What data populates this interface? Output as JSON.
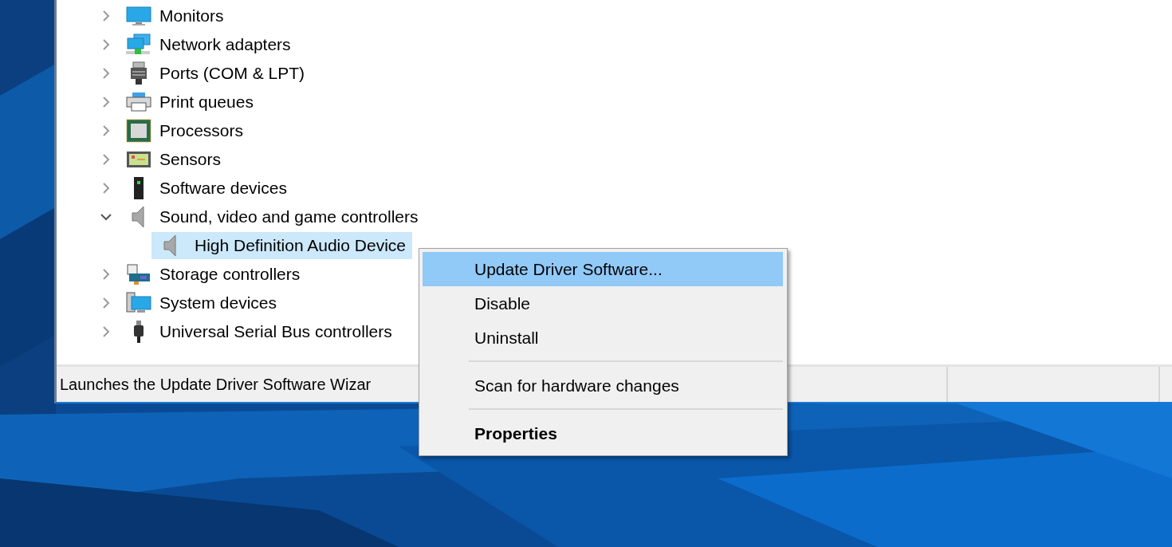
{
  "tree": [
    {
      "label": "Monitors",
      "expanded": false,
      "selected": false
    },
    {
      "label": "Network adapters",
      "expanded": false,
      "selected": false
    },
    {
      "label": "Ports (COM & LPT)",
      "expanded": false,
      "selected": false
    },
    {
      "label": "Print queues",
      "expanded": false,
      "selected": false
    },
    {
      "label": "Processors",
      "expanded": false,
      "selected": false
    },
    {
      "label": "Sensors",
      "expanded": false,
      "selected": false
    },
    {
      "label": "Software devices",
      "expanded": false,
      "selected": false
    },
    {
      "label": "Sound, video and game controllers",
      "expanded": true,
      "selected": false,
      "children": [
        {
          "label": "High Definition Audio Device",
          "selected": true
        }
      ]
    },
    {
      "label": "Storage controllers",
      "expanded": false,
      "selected": false
    },
    {
      "label": "System devices",
      "expanded": false,
      "selected": false
    },
    {
      "label": "Universal Serial Bus controllers",
      "expanded": false,
      "selected": false
    }
  ],
  "status_bar": {
    "text": "Launches the Update Driver Software Wizar"
  },
  "context_menu": [
    {
      "kind": "item",
      "label": "Update Driver Software...",
      "selected": true,
      "default": false
    },
    {
      "kind": "item",
      "label": "Disable",
      "selected": false,
      "default": false
    },
    {
      "kind": "item",
      "label": "Uninstall",
      "selected": false,
      "default": false
    },
    {
      "kind": "separator"
    },
    {
      "kind": "item",
      "label": "Scan for hardware changes",
      "selected": false,
      "default": false
    },
    {
      "kind": "separator"
    },
    {
      "kind": "item",
      "label": "Properties",
      "selected": false,
      "default": true
    }
  ]
}
